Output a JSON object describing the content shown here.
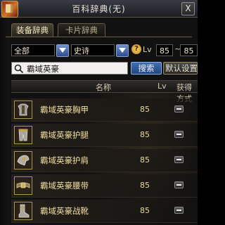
{
  "window": {
    "title": "百科辞典(无)",
    "close_label": "X"
  },
  "tabs": [
    {
      "label": "装备辞典",
      "active": true
    },
    {
      "label": "卡片辞典",
      "active": false
    }
  ],
  "filters": {
    "category": "全部",
    "rarity": "史诗",
    "help_label": "?",
    "lv_label": "Lv",
    "lv_min": "85",
    "lv_sep": "~",
    "lv_max": "85"
  },
  "search": {
    "value": "霸域英豪",
    "button_label": "搜索",
    "reset_label": "默认设置"
  },
  "table": {
    "headers": {
      "name": "名称",
      "lv": "Lv",
      "obtain": "获得方式"
    },
    "rows": [
      {
        "name": "霸域英豪胸甲",
        "lv": "85",
        "icon": "chest-armor-icon"
      },
      {
        "name": "霸域英豪护腿",
        "lv": "85",
        "icon": "leg-armor-icon"
      },
      {
        "name": "霸域英豪护肩",
        "lv": "85",
        "icon": "shoulder-armor-icon"
      },
      {
        "name": "霸域英豪腰带",
        "lv": "85",
        "icon": "belt-icon"
      },
      {
        "name": "霸域英豪战靴",
        "lv": "85",
        "icon": "boots-icon"
      }
    ]
  },
  "colors": {
    "accent": "#3f6fb0",
    "item_name": "#f2dfa0",
    "frame": "#b39a55"
  }
}
